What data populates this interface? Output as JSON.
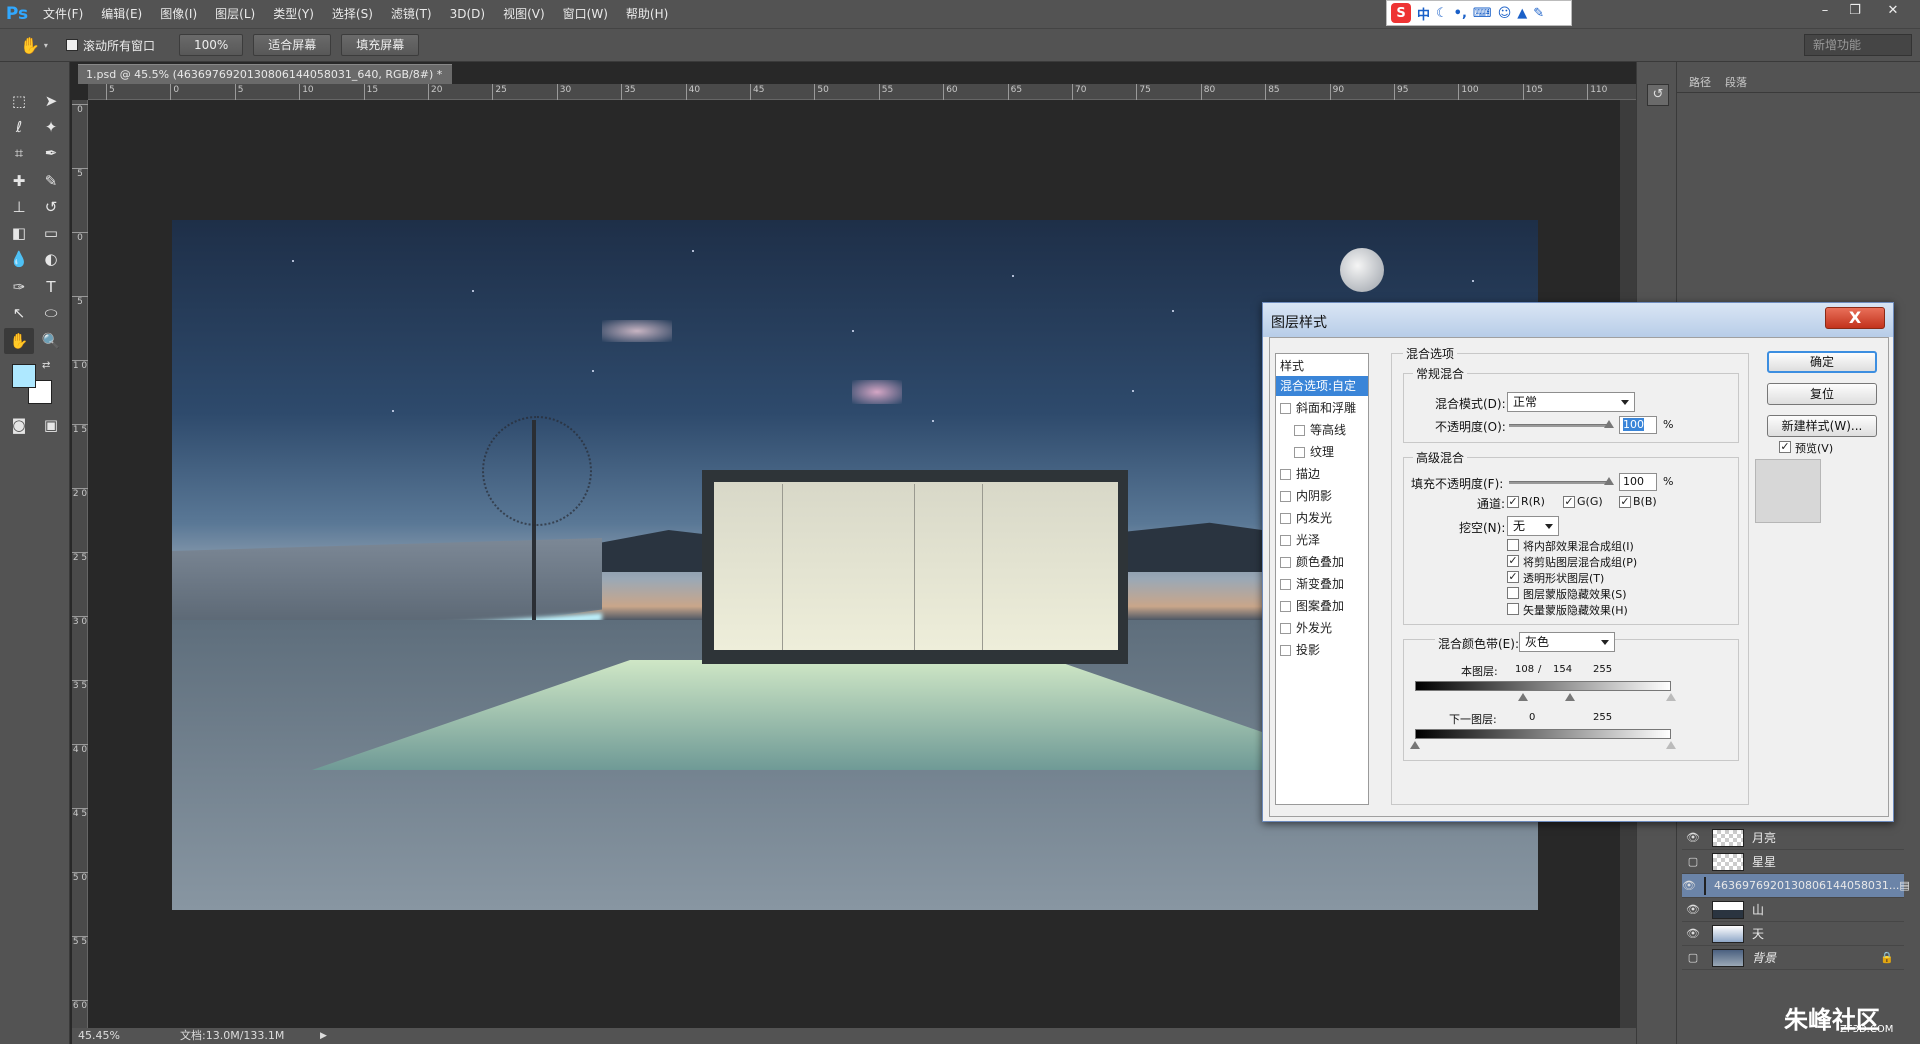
{
  "menubar": {
    "app_logo": "Ps",
    "items": [
      "文件(F)",
      "编辑(E)",
      "图像(I)",
      "图层(L)",
      "类型(Y)",
      "选择(S)",
      "滤镜(T)",
      "3D(D)",
      "视图(V)",
      "窗口(W)",
      "帮助(H)"
    ],
    "ime": {
      "logo": "S",
      "mode": "中"
    },
    "window_buttons": [
      "–",
      "❐",
      "✕"
    ]
  },
  "optionsbar": {
    "scroll_all_label": "滚动所有窗口",
    "btn_100": "100%",
    "btn_fit": "适合屏幕",
    "btn_fill": "填充屏幕",
    "workspace": "新增功能"
  },
  "document": {
    "tab_title": "1.psd @ 45.5% (4636976920130806144058031_640, RGB/8#) *",
    "tab_close": "×",
    "ruler_h": [
      "5",
      "0",
      "5",
      "10",
      "15",
      "20",
      "25",
      "30",
      "35",
      "40",
      "45",
      "50",
      "55",
      "60",
      "65",
      "70",
      "75",
      "80",
      "85",
      "90",
      "95",
      "100",
      "105",
      "110"
    ],
    "ruler_v": [
      "0",
      "5",
      "0",
      "5",
      "1 0",
      "1 5",
      "2 0",
      "2 5",
      "3 0",
      "3 5",
      "4 0",
      "4 5",
      "5 0",
      "5 5",
      "6 0"
    ]
  },
  "statusbar": {
    "zoom": "45.45%",
    "doc_info": "文档:13.0M/133.1M"
  },
  "panels": {
    "tab_paths": "路径",
    "tab_paragraph": "段落",
    "layers": [
      {
        "name": "月亮",
        "visible": true,
        "selected": false
      },
      {
        "name": "星星",
        "visible": false,
        "selected": false
      },
      {
        "name": "4636976920130806144058031...",
        "visible": true,
        "selected": true
      },
      {
        "name": "山",
        "visible": true,
        "selected": false
      },
      {
        "name": "天",
        "visible": true,
        "selected": false
      },
      {
        "name": "背景",
        "visible": false,
        "selected": false,
        "locked": true
      }
    ]
  },
  "dialog": {
    "title": "图层样式",
    "close": "X",
    "styles_header": "样式",
    "styles": [
      {
        "label": "混合选项:自定",
        "selected": true,
        "checkbox": false,
        "indent": false
      },
      {
        "label": "斜面和浮雕",
        "checkbox": true,
        "indent": false
      },
      {
        "label": "等高线",
        "checkbox": true,
        "indent": true
      },
      {
        "label": "纹理",
        "checkbox": true,
        "indent": true
      },
      {
        "label": "描边",
        "checkbox": true,
        "indent": false
      },
      {
        "label": "内阴影",
        "checkbox": true,
        "indent": false
      },
      {
        "label": "内发光",
        "checkbox": true,
        "indent": false
      },
      {
        "label": "光泽",
        "checkbox": true,
        "indent": false
      },
      {
        "label": "颜色叠加",
        "checkbox": true,
        "indent": false
      },
      {
        "label": "渐变叠加",
        "checkbox": true,
        "indent": false
      },
      {
        "label": "图案叠加",
        "checkbox": true,
        "indent": false
      },
      {
        "label": "外发光",
        "checkbox": true,
        "indent": false
      },
      {
        "label": "投影",
        "checkbox": true,
        "indent": false
      }
    ],
    "blend_options_title": "混合选项",
    "general_title": "常规混合",
    "blend_mode_label": "混合模式(D):",
    "blend_mode_value": "正常",
    "opacity_label": "不透明度(O):",
    "opacity_value": "100",
    "percent": "%",
    "advanced_title": "高级混合",
    "fill_opacity_label": "填充不透明度(F):",
    "fill_opacity_value": "100",
    "channels_label": "通道:",
    "channel_r": "R(R)",
    "channel_g": "G(G)",
    "channel_b": "B(B)",
    "knockout_label": "挖空(N):",
    "knockout_value": "无",
    "adv_checks": [
      {
        "label": "将内部效果混合成组(I)",
        "checked": false
      },
      {
        "label": "将剪贴图层混合成组(P)",
        "checked": true
      },
      {
        "label": "透明形状图层(T)",
        "checked": true
      },
      {
        "label": "图层蒙版隐藏效果(S)",
        "checked": false
      },
      {
        "label": "矢量蒙版隐藏效果(H)",
        "checked": false
      }
    ],
    "blend_if_label": "混合颜色带(E):",
    "blend_if_value": "灰色",
    "this_layer_label": "本图层:",
    "this_layer_black": "108",
    "this_layer_slash": "/",
    "this_layer_black2": "154",
    "this_layer_white": "255",
    "this_layer_black_level": 0.4235,
    "this_layer_black2_level": 0.6039,
    "this_layer_white_level": 1.0,
    "under_layer_label": "下一图层:",
    "under_layer_black": "0",
    "under_layer_white": "255",
    "under_layer_black_level": 0.0,
    "under_layer_white_level": 1.0,
    "btn_ok": "确定",
    "btn_reset": "复位",
    "btn_new_style": "新建样式(W)...",
    "preview_label": "预览(V)",
    "checkmark": "✓"
  },
  "watermark": {
    "title": "朱峰社区",
    "sub": "ZF3D.COM"
  }
}
